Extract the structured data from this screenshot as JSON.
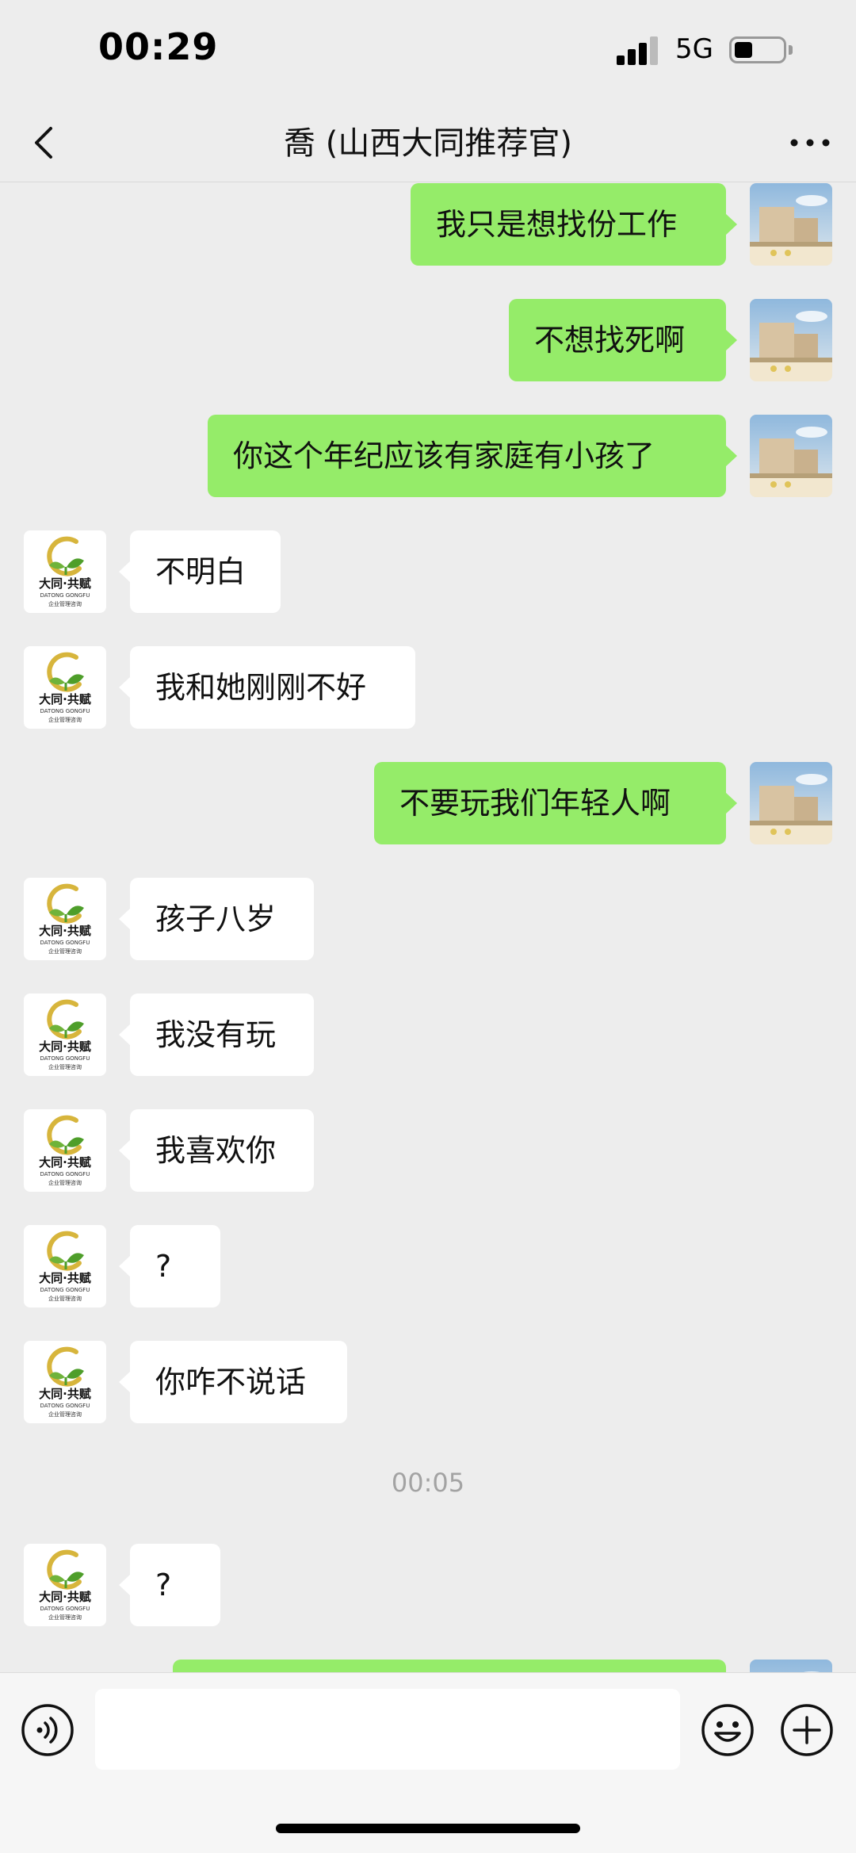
{
  "status_bar": {
    "time": "00:29",
    "network": "5G",
    "battery_level": 0.35
  },
  "nav": {
    "title": "喬 (山西大同推荐官)",
    "back_icon": "chevron-left-icon",
    "more_icon": "more-dots-icon"
  },
  "avatars": {
    "contact_logo_line1": "大同·共赋",
    "contact_logo_line2": "DATONG GONGFU",
    "contact_logo_line3": "企业管理咨询"
  },
  "messages": [
    {
      "side": "right",
      "text": "我只是想找份工作"
    },
    {
      "side": "right",
      "text": "不想找死啊"
    },
    {
      "side": "right",
      "text": "你这个年纪应该有家庭有小孩了"
    },
    {
      "side": "left",
      "text": "不明白"
    },
    {
      "side": "left",
      "text": "我和她刚刚不好"
    },
    {
      "side": "right",
      "text": "不要玩我们年轻人啊"
    },
    {
      "side": "left",
      "text": "孩子八岁"
    },
    {
      "side": "left",
      "text": "我没有玩"
    },
    {
      "side": "left",
      "text": "我喜欢你"
    },
    {
      "side": "left",
      "text": "?"
    },
    {
      "side": "left",
      "text": "你咋不说话"
    },
    {
      "side": "time",
      "text": "00:05"
    },
    {
      "side": "left",
      "text": "?"
    },
    {
      "side": "right",
      "text": ""
    }
  ],
  "input_bar": {
    "placeholder": "",
    "voice_icon": "voice-icon",
    "emoji_icon": "emoji-icon",
    "plus_icon": "plus-icon"
  }
}
